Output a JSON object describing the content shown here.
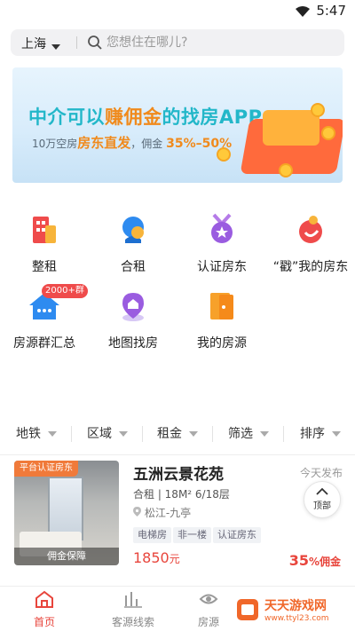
{
  "status_bar": {
    "time": "5:47",
    "icon": "wifi-icon"
  },
  "search": {
    "city": "上海",
    "placeholder": "您想住在哪儿?"
  },
  "banner": {
    "title_part1": "中介可以",
    "title_highlight": "赚佣金",
    "title_part2": "的找房APP",
    "sub_part1": "10万空房",
    "sub_highlight": "房东直发",
    "sub_part2": "，佣金",
    "sub_range": "35%–50%"
  },
  "grid": [
    {
      "label": "整租",
      "icon": "building-icon"
    },
    {
      "label": "合租",
      "icon": "people-icon"
    },
    {
      "label": "认证房东",
      "icon": "medal-icon"
    },
    {
      "label": "“戳”我的房东",
      "icon": "hand-icon"
    },
    {
      "label": "房源群汇总",
      "icon": "chat-house-icon",
      "badge": "2000+群"
    },
    {
      "label": "地图找房",
      "icon": "map-pin-icon"
    },
    {
      "label": "我的房源",
      "icon": "door-icon"
    }
  ],
  "filters": [
    "地铁",
    "区域",
    "租金",
    "筛选",
    "排序"
  ],
  "listing": {
    "cert_tag": "平台认证房东",
    "guarantee": "佣金保障",
    "title": "五洲云景花苑",
    "date": "今天发布",
    "meta": "合租 | 18M²  6/18层",
    "location": "松江-九亭",
    "chips": [
      "电梯房",
      "非一楼",
      "认证房东"
    ],
    "price_value": "1850",
    "price_unit": "元",
    "commission_value": "35",
    "commission_unit": "%佣金"
  },
  "back_to_top": "顶部",
  "tabs": [
    {
      "label": "首页",
      "icon": "home-icon",
      "active": true
    },
    {
      "label": "客源线索",
      "icon": "chart-icon",
      "active": false
    },
    {
      "label": "房源",
      "icon": "eye-icon",
      "active": false
    }
  ],
  "watermark": {
    "text": "天天游戏网",
    "url": "www.ttyl23.com"
  },
  "colors": {
    "accent": "#e8453c",
    "banner_teal": "#23b7c9",
    "banner_orange": "#f08a1c"
  }
}
